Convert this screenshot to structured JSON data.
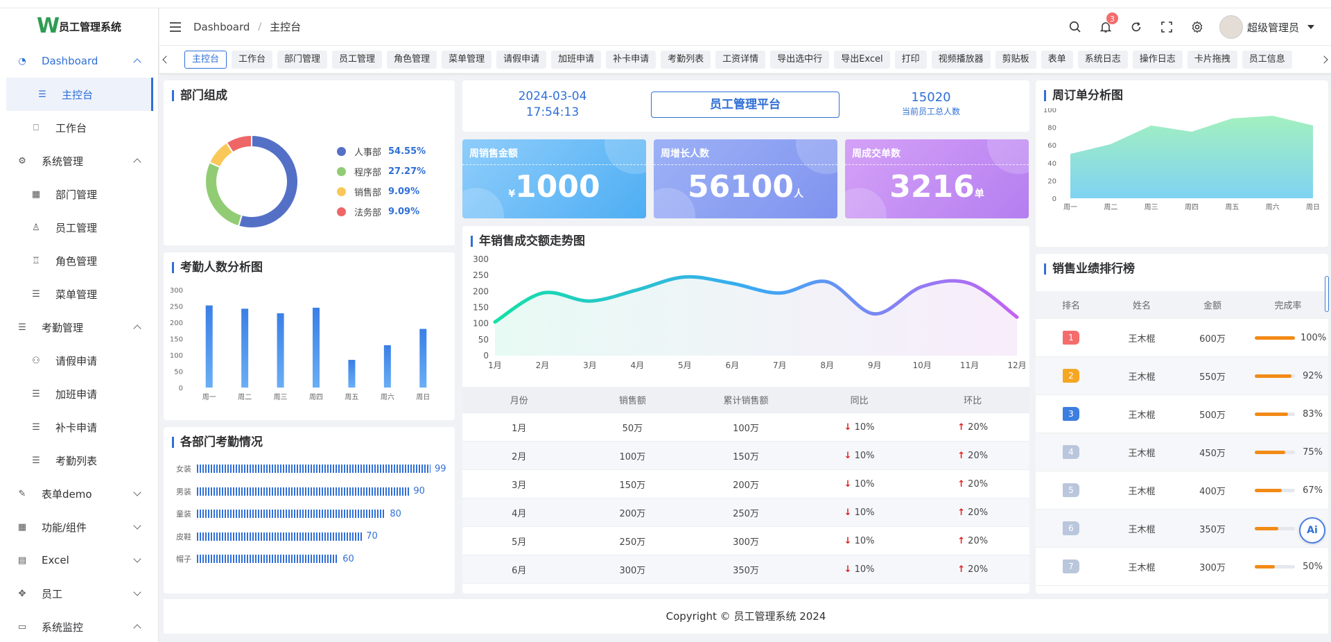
{
  "app": {
    "title": "员工管理系统",
    "logo_letter": "W"
  },
  "header": {
    "breadcrumb": [
      "Dashboard",
      "主控台"
    ],
    "notification_count": "3",
    "user_name": "超级管理员"
  },
  "sidebar": {
    "items": [
      {
        "label": "Dashboard",
        "level": 1,
        "icon": "dashboard-icon",
        "expanded": true
      },
      {
        "label": "主控台",
        "level": 2,
        "icon": "list-icon",
        "active": true
      },
      {
        "label": "工作台",
        "level": 2,
        "icon": "bookmark-icon"
      },
      {
        "label": "系统管理",
        "level": 1,
        "icon": "gear-icon",
        "expanded": true
      },
      {
        "label": "部门管理",
        "level": 2,
        "icon": "grid-icon"
      },
      {
        "label": "员工管理",
        "level": 2,
        "icon": "user-icon"
      },
      {
        "label": "角色管理",
        "level": 2,
        "icon": "stamp-icon"
      },
      {
        "label": "菜单管理",
        "level": 2,
        "icon": "list-icon"
      },
      {
        "label": "考勤管理",
        "level": 1,
        "icon": "list-icon",
        "expanded": true
      },
      {
        "label": "请假申请",
        "level": 2,
        "icon": "users-icon"
      },
      {
        "label": "加班申请",
        "level": 2,
        "icon": "list-icon"
      },
      {
        "label": "补卡申请",
        "level": 2,
        "icon": "list-icon"
      },
      {
        "label": "考勤列表",
        "level": 2,
        "icon": "list-icon"
      },
      {
        "label": "表单demo",
        "level": 1,
        "icon": "edit-icon",
        "expanded": false
      },
      {
        "label": "功能/组件",
        "level": 1,
        "icon": "grid-icon",
        "expanded": false
      },
      {
        "label": "Excel",
        "level": 1,
        "icon": "table-icon",
        "expanded": false
      },
      {
        "label": "员工",
        "level": 1,
        "icon": "move-icon",
        "expanded": false
      },
      {
        "label": "系统监控",
        "level": 1,
        "icon": "monitor-icon",
        "expanded": true
      }
    ]
  },
  "tags": [
    "主控台",
    "工作台",
    "部门管理",
    "员工管理",
    "角色管理",
    "菜单管理",
    "请假申请",
    "加班申请",
    "补卡申请",
    "考勤列表",
    "工资详情",
    "导出选中行",
    "导出Excel",
    "打印",
    "视频播放器",
    "剪贴板",
    "表单",
    "系统日志",
    "操作日志",
    "卡片拖拽",
    "员工信息"
  ],
  "dept_composition": {
    "title": "部门组成",
    "items": [
      {
        "name": "人事部",
        "pct": "54.55%",
        "value": 54.55,
        "color": "#5470c6"
      },
      {
        "name": "程序部",
        "pct": "27.27%",
        "value": 27.27,
        "color": "#91cc75"
      },
      {
        "name": "销售部",
        "pct": "9.09%",
        "value": 9.09,
        "color": "#fac858"
      },
      {
        "name": "法务部",
        "pct": "9.09%",
        "value": 9.09,
        "color": "#ee6666"
      }
    ]
  },
  "summary": {
    "date": "2024-03-04",
    "time": "17:54:13",
    "platform": "员工管理平台",
    "employee_total": "15020",
    "employee_total_label": "当前员工总人数"
  },
  "stats": [
    {
      "title": "周销售金额",
      "prefix": "¥",
      "value": "1000",
      "unit": ""
    },
    {
      "title": "周增长人数",
      "prefix": "",
      "value": "56100",
      "unit": "人"
    },
    {
      "title": "周成交单数",
      "prefix": "",
      "value": "3216",
      "unit": "单"
    }
  ],
  "chart_data": [
    {
      "type": "area",
      "title": "周订单分析图",
      "categories": [
        "周一",
        "周二",
        "周三",
        "周四",
        "周五",
        "周六",
        "周日"
      ],
      "values": [
        50,
        61,
        82,
        75,
        90,
        93,
        82
      ],
      "ylim": [
        0,
        100
      ],
      "yticks": [
        0,
        20,
        40,
        60,
        80,
        100
      ],
      "color": "#8ee6b6"
    },
    {
      "type": "bar",
      "title": "考勤人数分析图",
      "categories": [
        "周一",
        "周二",
        "周三",
        "周四",
        "周五",
        "周六",
        "周日"
      ],
      "values": [
        252,
        242,
        228,
        245,
        85,
        130,
        180
      ],
      "ylim": [
        0,
        300
      ],
      "yticks": [
        0,
        50,
        100,
        150,
        200,
        250,
        300
      ]
    },
    {
      "type": "line",
      "title": "年销售成交额走势图",
      "categories": [
        "1月",
        "2月",
        "3月",
        "4月",
        "5月",
        "6月",
        "7月",
        "8月",
        "9月",
        "10月",
        "11月",
        "12月"
      ],
      "values": [
        105,
        195,
        170,
        205,
        245,
        225,
        195,
        230,
        130,
        215,
        225,
        120
      ],
      "ylim": [
        0,
        300
      ],
      "yticks": [
        0,
        50,
        100,
        150,
        200,
        250,
        300
      ]
    },
    {
      "type": "bar",
      "title": "各部门考勤情况",
      "categories": [
        "女装",
        "男装",
        "童装",
        "皮鞋",
        "帽子"
      ],
      "values": [
        99,
        90,
        80,
        70,
        60
      ]
    }
  ],
  "sales_table": {
    "headers": [
      "月份",
      "销售额",
      "累计销售额",
      "同比",
      "环比"
    ],
    "rows": [
      [
        "1月",
        "50万",
        "100万",
        "10%",
        "20%"
      ],
      [
        "2月",
        "100万",
        "150万",
        "10%",
        "20%"
      ],
      [
        "3月",
        "150万",
        "200万",
        "10%",
        "20%"
      ],
      [
        "4月",
        "200万",
        "250万",
        "10%",
        "20%"
      ],
      [
        "5月",
        "250万",
        "300万",
        "10%",
        "20%"
      ],
      [
        "6月",
        "300万",
        "350万",
        "10%",
        "20%"
      ]
    ],
    "arrow_down": "↓",
    "arrow_up": "↑"
  },
  "ranking": {
    "title": "销售业绩排行榜",
    "headers": [
      "排名",
      "姓名",
      "金额",
      "完成率"
    ],
    "rows": [
      {
        "rank": "1",
        "name": "王木棍",
        "amount": "600万",
        "rate": "100%",
        "value": 100,
        "color": "#f56c6c"
      },
      {
        "rank": "2",
        "name": "王木棍",
        "amount": "550万",
        "rate": "92%",
        "value": 92,
        "color": "#f5a623"
      },
      {
        "rank": "3",
        "name": "王木棍",
        "amount": "500万",
        "rate": "83%",
        "value": 83,
        "color": "#3d7ee0"
      },
      {
        "rank": "4",
        "name": "王木棍",
        "amount": "450万",
        "rate": "75%",
        "value": 75,
        "color": "#b9c6dc"
      },
      {
        "rank": "5",
        "name": "王木棍",
        "amount": "400万",
        "rate": "67%",
        "value": 67,
        "color": "#b9c6dc"
      },
      {
        "rank": "6",
        "name": "王木棍",
        "amount": "350万",
        "rate": "58%",
        "value": 58,
        "color": "#b9c6dc"
      },
      {
        "rank": "7",
        "name": "王木棍",
        "amount": "300万",
        "rate": "50%",
        "value": 50,
        "color": "#b9c6dc"
      }
    ]
  },
  "footer": "Copyright © 员工管理系统 2024",
  "ai_button": "Ai"
}
